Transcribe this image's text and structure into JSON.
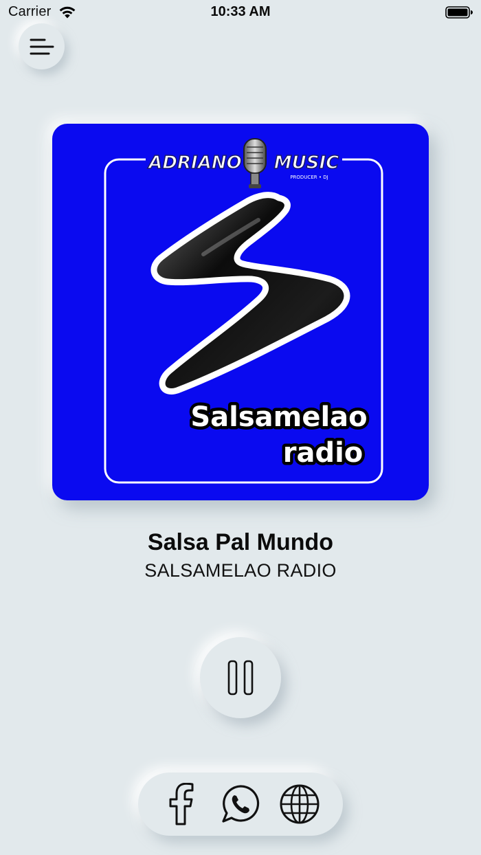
{
  "status_bar": {
    "carrier": "Carrier",
    "time": "10:33 AM"
  },
  "menu": {
    "icon": "menu-lines-icon"
  },
  "artwork": {
    "background_color": "#0a0af0",
    "logo_top_left": "ADRIANO",
    "logo_top_right": "MUSIC",
    "logo_tagline": "PRODUCER • DJ",
    "logo_line1": "Salsamelao",
    "logo_line2": "radio"
  },
  "now_playing": {
    "title": "Salsa Pal Mundo",
    "subtitle": "SALSAMELAO RADIO"
  },
  "player": {
    "state_icon": "pause-icon"
  },
  "social": {
    "items": [
      {
        "name": "facebook",
        "icon": "facebook-icon"
      },
      {
        "name": "whatsapp",
        "icon": "whatsapp-icon"
      },
      {
        "name": "website",
        "icon": "globe-icon"
      }
    ]
  }
}
